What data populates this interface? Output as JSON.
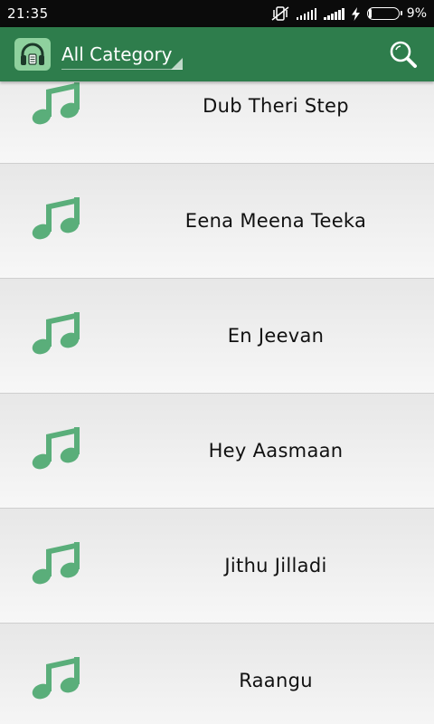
{
  "status_bar": {
    "time": "21:35",
    "battery_percent": "9%",
    "battery_level": 0.09,
    "icons": [
      "mute-vibrate-icon",
      "signal-icon",
      "signal-icon",
      "charging-bolt-icon",
      "battery-icon"
    ]
  },
  "app_bar": {
    "logo_icon": "headphones-music-icon",
    "category_label": "All Category",
    "search_icon": "search-icon",
    "background": "#2e7d4c"
  },
  "song_list": {
    "item_icon": "music-note-icon",
    "icon_color": "#5aae7a",
    "items": [
      {
        "title": "Dub Theri Step"
      },
      {
        "title": "Eena Meena Teeka"
      },
      {
        "title": "En Jeevan"
      },
      {
        "title": "Hey Aasmaan"
      },
      {
        "title": "Jithu Jilladi"
      },
      {
        "title": "Raangu"
      }
    ]
  }
}
